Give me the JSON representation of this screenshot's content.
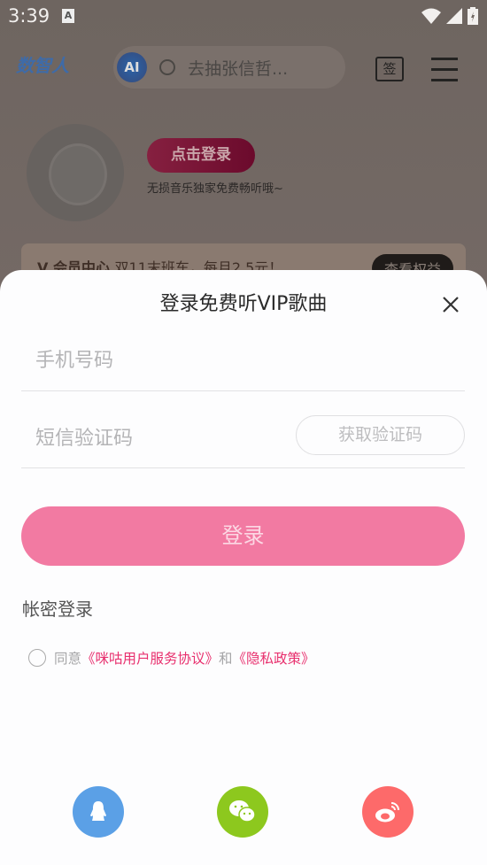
{
  "status_bar": {
    "time": "3:39",
    "notification_icon": "A"
  },
  "header": {
    "logo": "数智人",
    "ai_badge": "AI",
    "search_placeholder": "去抽张信哲...",
    "sign_label": "签",
    "icons": [
      "search-icon",
      "sign-in-calendar-icon",
      "menu-icon"
    ]
  },
  "profile": {
    "login_button": "点击登录",
    "tagline": "无损音乐独家免费畅听哦~"
  },
  "banner": {
    "title": "V 会员中心",
    "promo": "双11末班车，每月2.5元！",
    "button": "查看权益"
  },
  "login_sheet": {
    "title": "登录免费听VIP歌曲",
    "phone_placeholder": "手机号码",
    "code_placeholder": "短信验证码",
    "get_code_button": "获取验证码",
    "submit_button": "登录",
    "password_login": "帐密登录",
    "agreement": {
      "prefix": "同意",
      "terms": "《咪咕用户服务协议》",
      "and": "和",
      "privacy": "《隐私政策》"
    },
    "social": [
      {
        "name": "qq",
        "color": "#5ba0e6"
      },
      {
        "name": "wechat",
        "color": "#8dc81e"
      },
      {
        "name": "weibo",
        "color": "#fd6a6a"
      }
    ]
  },
  "colors": {
    "accent": "#f27aa2",
    "link": "#e8306e"
  }
}
